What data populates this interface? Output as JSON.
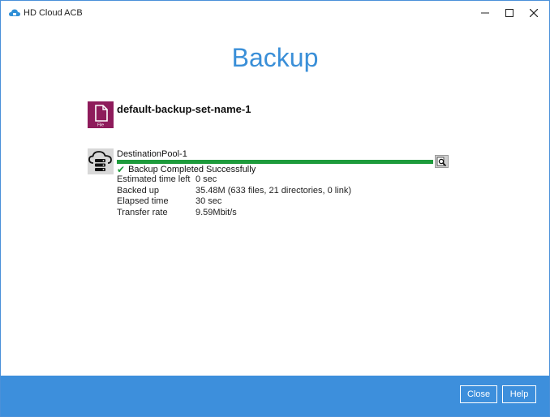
{
  "window": {
    "title": "HD Cloud ACB",
    "controls": {
      "minimize": "—",
      "maximize": "☐",
      "close": "✕"
    }
  },
  "page": {
    "title": "Backup"
  },
  "backup_set": {
    "name": "default-backup-set-name-1",
    "icon": "file-icon",
    "icon_label": "File",
    "icon_color": "#8e1b5b"
  },
  "destination": {
    "name": "DestinationPool-1",
    "icon": "cloud-server-icon",
    "progress_percent": 100,
    "progress_color": "#1e9b3c",
    "status": "Backup Completed Successfully",
    "stats": [
      {
        "label": "Estimated time left",
        "value": "0 sec"
      },
      {
        "label": "Backed up",
        "value": "35.48M (633 files, 21 directories, 0 link)"
      },
      {
        "label": "Elapsed time",
        "value": "30 sec"
      },
      {
        "label": "Transfer rate",
        "value": "9.59Mbit/s"
      }
    ]
  },
  "footer": {
    "close_label": "Close",
    "help_label": "Help",
    "background": "#3d8fdc"
  }
}
